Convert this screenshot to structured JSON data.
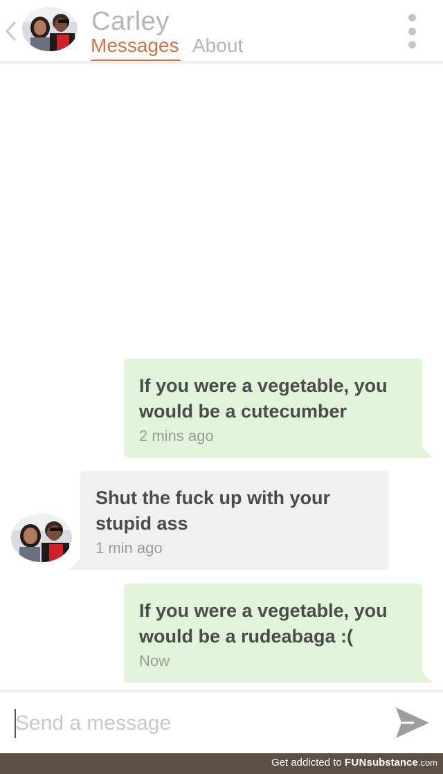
{
  "header": {
    "back_icon": "chevron-left-icon",
    "contact_name": "Carley",
    "tabs": [
      {
        "label": "Messages",
        "active": true
      },
      {
        "label": "About",
        "active": false
      }
    ],
    "menu_icon": "more-vertical-icon",
    "accent_color": "#d66f45"
  },
  "messages": [
    {
      "direction": "sent",
      "text": "If you were a vegetable, you would be a cutecumber",
      "lines": [
        "If you were a vegetable, you",
        "would be a cutecumber"
      ],
      "time": "2 mins ago"
    },
    {
      "direction": "received",
      "text": "Shut the fuck up with your stupid ass",
      "lines": [
        "Shut the fuck up with your",
        "stupid ass"
      ],
      "time": "1 min ago"
    },
    {
      "direction": "sent",
      "text": "If you were a vegetable, you would be a rudeabaga :(",
      "lines": [
        "If you were a vegetable, you",
        "would be a rudeabaga :("
      ],
      "time": "Now"
    }
  ],
  "composer": {
    "placeholder": "Send a message",
    "send_icon": "send-icon"
  },
  "watermark": {
    "prefix": "Get addicted to",
    "brand_bold": "FUN",
    "brand_rest": "substance",
    "suffix": ".com"
  },
  "colors": {
    "sent_bubble": "#e1f3d8",
    "received_bubble": "#f0f0f0",
    "watermark_bar": "#5b4f46"
  }
}
